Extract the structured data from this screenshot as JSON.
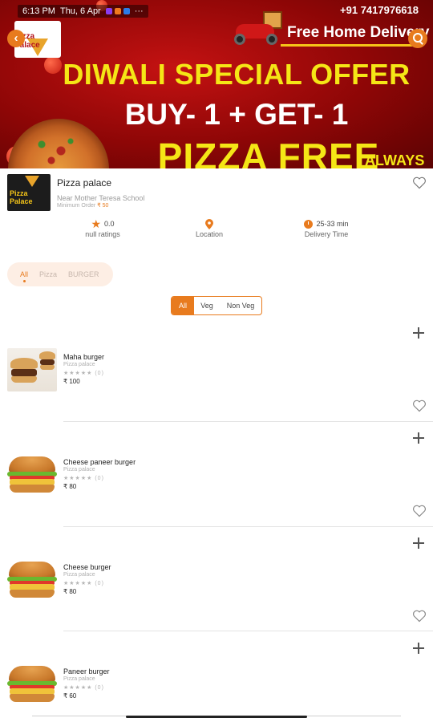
{
  "status_bar": {
    "time": "6:13 PM",
    "date": "Thu, 6 Apr",
    "more": "···",
    "right_text": "+91 7417976618"
  },
  "banner": {
    "logo_text": "Pizza Palace",
    "delivery": "Free Home Delivery",
    "line1": "DIWALI SPECIAL OFFER",
    "line2": "BUY- 1 + GET- 1",
    "line3": "PIZZA FREE",
    "line4": "ALWAYS"
  },
  "restaurant": {
    "logo_text": "Pizza Palace",
    "name": "Pizza palace",
    "address": "Near Mother Teresa School",
    "min_order_label": "Minimum Order",
    "min_order_value": "₹ 50",
    "stats": [
      {
        "value": "0.0",
        "label": "null ratings",
        "icon": "star-icon"
      },
      {
        "value": "",
        "label": "Location",
        "icon": "location-pin-icon"
      },
      {
        "value": "25-33 min",
        "label": "Delivery Time",
        "icon": "clock-icon"
      }
    ]
  },
  "categories": [
    "All",
    "Pizza",
    "BURGER"
  ],
  "veg_filter": [
    "All",
    "Veg",
    "Non Veg"
  ],
  "foods": [
    {
      "name": "Maha burger",
      "restaurant": "Pizza palace",
      "stars": "★★★★★",
      "count": "(0)",
      "price": "₹ 100"
    },
    {
      "name": "Cheese paneer burger",
      "restaurant": "Pizza palace",
      "stars": "★★★★★",
      "count": "(0)",
      "price": "₹ 80"
    },
    {
      "name": "Cheese burger",
      "restaurant": "Pizza palace",
      "stars": "★★★★★",
      "count": "(0)",
      "price": "₹ 80"
    },
    {
      "name": "Paneer burger",
      "restaurant": "Pizza palace",
      "stars": "★★★★★",
      "count": "(0)",
      "price": "₹ 60"
    }
  ],
  "colors": {
    "accent": "#e87b1e",
    "banner_red": "#a30a0a",
    "banner_yellow": "#f5e616"
  }
}
